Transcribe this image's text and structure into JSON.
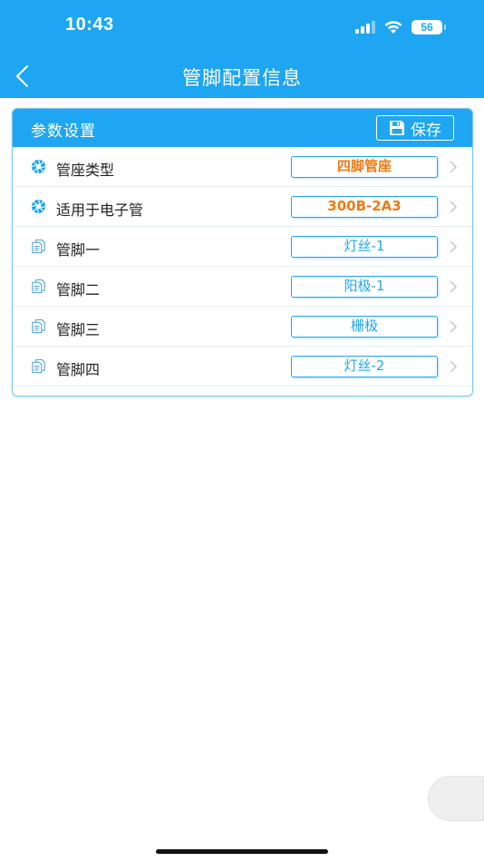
{
  "status_bar": {
    "time": "10:43",
    "battery": "56"
  },
  "nav": {
    "title": "管脚配置信息"
  },
  "card": {
    "title": "参数设置",
    "save_label": "保存",
    "rows": [
      {
        "label": "管座类型",
        "value": "四脚管座",
        "icon": "aperture-icon",
        "style": "orange"
      },
      {
        "label": "适用于电子管",
        "value": "300B-2A3",
        "icon": "aperture-icon",
        "style": "orange"
      },
      {
        "label": "管脚一",
        "value": "灯丝-1",
        "icon": "document-icon",
        "style": "blue"
      },
      {
        "label": "管脚二",
        "value": "阳极-1",
        "icon": "document-icon",
        "style": "blue"
      },
      {
        "label": "管脚三",
        "value": "栅极",
        "icon": "document-icon",
        "style": "blue"
      },
      {
        "label": "管脚四",
        "value": "灯丝-2",
        "icon": "document-icon",
        "style": "blue"
      }
    ]
  },
  "colors": {
    "primary": "#1ea6f2",
    "accent": "#f07a12",
    "text": "#222222"
  }
}
